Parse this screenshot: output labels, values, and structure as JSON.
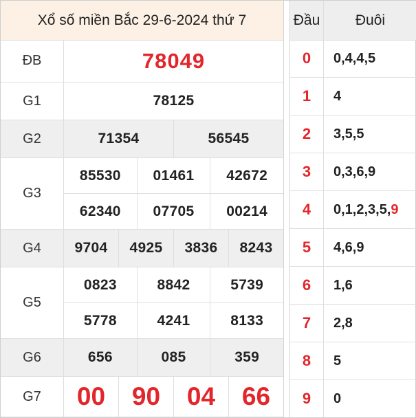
{
  "title": "Xổ số miền Bắc 29-6-2024 thứ 7",
  "prizes": [
    {
      "label": "ĐB",
      "rows": [
        [
          "78049"
        ]
      ]
    },
    {
      "label": "G1",
      "rows": [
        [
          "78125"
        ]
      ]
    },
    {
      "label": "G2",
      "rows": [
        [
          "71354",
          "56545"
        ]
      ]
    },
    {
      "label": "G3",
      "rows": [
        [
          "85530",
          "01461",
          "42672"
        ],
        [
          "62340",
          "07705",
          "00214"
        ]
      ]
    },
    {
      "label": "G4",
      "rows": [
        [
          "9704",
          "4925",
          "3836",
          "8243"
        ]
      ]
    },
    {
      "label": "G5",
      "rows": [
        [
          "0823",
          "8842",
          "5739"
        ],
        [
          "5778",
          "4241",
          "8133"
        ]
      ]
    },
    {
      "label": "G6",
      "rows": [
        [
          "656",
          "085",
          "359"
        ]
      ]
    },
    {
      "label": "G7",
      "rows": [
        [
          "00",
          "90",
          "04",
          "66"
        ]
      ]
    }
  ],
  "loto": {
    "head_label": "Đầu",
    "tail_label": "Đuôi",
    "rows": [
      {
        "head": "0",
        "tail": "0,4,4,5",
        "tail_highlight": ""
      },
      {
        "head": "1",
        "tail": "4",
        "tail_highlight": ""
      },
      {
        "head": "2",
        "tail": "3,5,5",
        "tail_highlight": ""
      },
      {
        "head": "3",
        "tail": "0,3,6,9",
        "tail_highlight": ""
      },
      {
        "head": "4",
        "tail": "0,1,2,3,5,",
        "tail_highlight": "9"
      },
      {
        "head": "5",
        "tail": "4,6,9",
        "tail_highlight": ""
      },
      {
        "head": "6",
        "tail": "1,6",
        "tail_highlight": ""
      },
      {
        "head": "7",
        "tail": "2,8",
        "tail_highlight": ""
      },
      {
        "head": "8",
        "tail": "5",
        "tail_highlight": ""
      },
      {
        "head": "9",
        "tail": "0",
        "tail_highlight": ""
      }
    ]
  },
  "colors": {
    "accent_red": "#e3262b",
    "title_bg": "#fdf1e6",
    "alt_row_bg": "#efefef"
  }
}
